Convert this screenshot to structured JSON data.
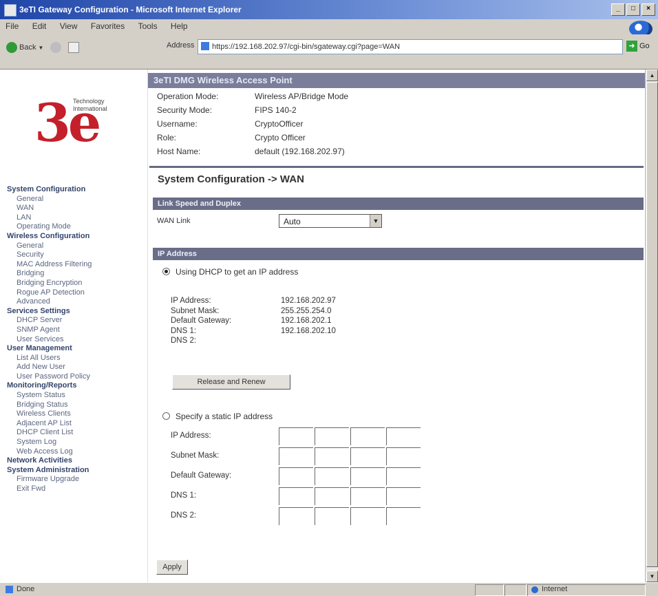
{
  "window": {
    "title": "3eTI Gateway Configuration - Microsoft Internet Explorer",
    "controls": [
      "_",
      "□",
      "×"
    ]
  },
  "menu": [
    "File",
    "Edit",
    "View",
    "Favorites",
    "Tools",
    "Help"
  ],
  "toolbar": {
    "back_label": "Back",
    "address_label": "Address",
    "url": "https://192.168.202.97/cgi-bin/sgateway.cgi?page=WAN",
    "go_label": "Go"
  },
  "logo": {
    "mark": "3e",
    "line1": "Technology",
    "line2": "International"
  },
  "nav": [
    {
      "label": "System Configuration",
      "kind": "sec"
    },
    {
      "label": "General",
      "kind": "sub"
    },
    {
      "label": "WAN",
      "kind": "sub"
    },
    {
      "label": "LAN",
      "kind": "sub"
    },
    {
      "label": "Operating Mode",
      "kind": "sub"
    },
    {
      "label": "Wireless Configuration",
      "kind": "sec"
    },
    {
      "label": "General",
      "kind": "sub"
    },
    {
      "label": "Security",
      "kind": "sub"
    },
    {
      "label": "MAC Address Filtering",
      "kind": "sub"
    },
    {
      "label": "Bridging",
      "kind": "sub"
    },
    {
      "label": "Bridging Encryption",
      "kind": "sub"
    },
    {
      "label": "Rogue AP Detection",
      "kind": "sub"
    },
    {
      "label": "Advanced",
      "kind": "sub"
    },
    {
      "label": "Services Settings",
      "kind": "sec"
    },
    {
      "label": "DHCP Server",
      "kind": "sub"
    },
    {
      "label": "SNMP Agent",
      "kind": "sub"
    },
    {
      "label": "User Services",
      "kind": "sub"
    },
    {
      "label": "User Management",
      "kind": "sec"
    },
    {
      "label": "List All Users",
      "kind": "sub"
    },
    {
      "label": "Add New User",
      "kind": "sub"
    },
    {
      "label": "User Password Policy",
      "kind": "sub"
    },
    {
      "label": "Monitoring/Reports",
      "kind": "sec"
    },
    {
      "label": "System Status",
      "kind": "sub"
    },
    {
      "label": "Bridging Status",
      "kind": "sub"
    },
    {
      "label": "Wireless Clients",
      "kind": "sub"
    },
    {
      "label": "Adjacent AP List",
      "kind": "sub"
    },
    {
      "label": "DHCP Client List",
      "kind": "sub"
    },
    {
      "label": "System Log",
      "kind": "sub"
    },
    {
      "label": "Web Access Log",
      "kind": "sub"
    },
    {
      "label": "Network Activities",
      "kind": "sec"
    },
    {
      "label": "System Administration",
      "kind": "sec"
    },
    {
      "label": "Firmware Upgrade",
      "kind": "sub"
    },
    {
      "label": "Exit Fwd",
      "kind": "sub"
    }
  ],
  "header": {
    "title": "3eTI DMG Wireless Access Point"
  },
  "info": [
    {
      "key": "Operation Mode:",
      "value": "Wireless AP/Bridge Mode"
    },
    {
      "key": "Security Mode:",
      "value": "FIPS 140-2"
    },
    {
      "key": "Username:",
      "value": "CryptoOfficer"
    },
    {
      "key": "Role:",
      "value": "Crypto Officer"
    },
    {
      "key": "Host Name:",
      "value": "default (192.168.202.97)"
    }
  ],
  "page_title": "System Configuration -> WAN",
  "link_section": {
    "title": "Link Speed and Duplex",
    "wan_link_label": "WAN Link",
    "wan_link_value": "Auto"
  },
  "ip_section": {
    "title": "IP Address",
    "dhcp_label": "Using DHCP to get an IP address",
    "dhcp_selected": true,
    "dhcp_rows": [
      {
        "key": "IP Address:",
        "value": "192.168.202.97"
      },
      {
        "key": "Subnet Mask:",
        "value": "255.255.254.0"
      },
      {
        "key": "Default Gateway:",
        "value": "192.168.202.1"
      },
      {
        "key": "DNS 1:",
        "value": "192.168.202.10"
      },
      {
        "key": "DNS 2:",
        "value": ""
      }
    ],
    "release_button": "Release and Renew",
    "static_label": "Specify a static IP address",
    "static_selected": false,
    "static_rows": [
      "IP Address:",
      "Subnet Mask:",
      "Default Gateway:",
      "DNS 1:",
      "DNS 2:"
    ]
  },
  "apply_button": "Apply",
  "status": {
    "left": "Done",
    "zone": "Internet"
  },
  "colors": {
    "header_bar": "#7a7e9b",
    "section_bar": "#6a6d88",
    "logo": "#c3202b"
  }
}
